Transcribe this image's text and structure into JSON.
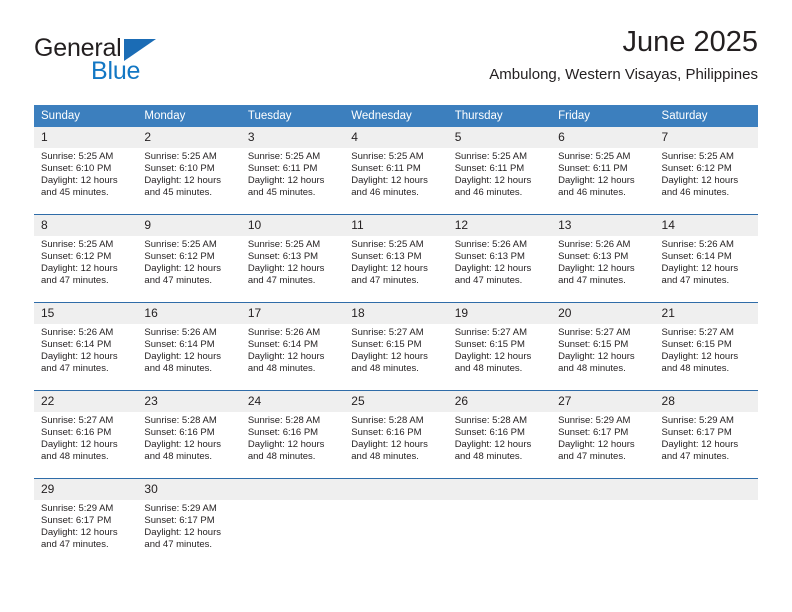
{
  "brand": {
    "name_part1": "General",
    "name_part2": "Blue",
    "triangle_color": "#1b6cb5"
  },
  "header": {
    "title": "June 2025",
    "subtitle": "Ambulong, Western Visayas, Philippines"
  },
  "theme": {
    "header_row_bg": "#3c7fbe",
    "row_divider": "#2f6ca8",
    "daynum_bg": "#efefef",
    "text": "#231f20"
  },
  "weekday_headers": [
    "Sunday",
    "Monday",
    "Tuesday",
    "Wednesday",
    "Thursday",
    "Friday",
    "Saturday"
  ],
  "labels": {
    "sunrise_prefix": "Sunrise:",
    "sunset_prefix": "Sunset:",
    "daylight_prefix": "Daylight:"
  },
  "weeks": [
    [
      {
        "day": "1",
        "sunrise": "Sunrise: 5:25 AM",
        "sunset": "Sunset: 6:10 PM",
        "daylight_line1": "Daylight: 12 hours",
        "daylight_line2": "and 45 minutes."
      },
      {
        "day": "2",
        "sunrise": "Sunrise: 5:25 AM",
        "sunset": "Sunset: 6:10 PM",
        "daylight_line1": "Daylight: 12 hours",
        "daylight_line2": "and 45 minutes."
      },
      {
        "day": "3",
        "sunrise": "Sunrise: 5:25 AM",
        "sunset": "Sunset: 6:11 PM",
        "daylight_line1": "Daylight: 12 hours",
        "daylight_line2": "and 45 minutes."
      },
      {
        "day": "4",
        "sunrise": "Sunrise: 5:25 AM",
        "sunset": "Sunset: 6:11 PM",
        "daylight_line1": "Daylight: 12 hours",
        "daylight_line2": "and 46 minutes."
      },
      {
        "day": "5",
        "sunrise": "Sunrise: 5:25 AM",
        "sunset": "Sunset: 6:11 PM",
        "daylight_line1": "Daylight: 12 hours",
        "daylight_line2": "and 46 minutes."
      },
      {
        "day": "6",
        "sunrise": "Sunrise: 5:25 AM",
        "sunset": "Sunset: 6:11 PM",
        "daylight_line1": "Daylight: 12 hours",
        "daylight_line2": "and 46 minutes."
      },
      {
        "day": "7",
        "sunrise": "Sunrise: 5:25 AM",
        "sunset": "Sunset: 6:12 PM",
        "daylight_line1": "Daylight: 12 hours",
        "daylight_line2": "and 46 minutes."
      }
    ],
    [
      {
        "day": "8",
        "sunrise": "Sunrise: 5:25 AM",
        "sunset": "Sunset: 6:12 PM",
        "daylight_line1": "Daylight: 12 hours",
        "daylight_line2": "and 47 minutes."
      },
      {
        "day": "9",
        "sunrise": "Sunrise: 5:25 AM",
        "sunset": "Sunset: 6:12 PM",
        "daylight_line1": "Daylight: 12 hours",
        "daylight_line2": "and 47 minutes."
      },
      {
        "day": "10",
        "sunrise": "Sunrise: 5:25 AM",
        "sunset": "Sunset: 6:13 PM",
        "daylight_line1": "Daylight: 12 hours",
        "daylight_line2": "and 47 minutes."
      },
      {
        "day": "11",
        "sunrise": "Sunrise: 5:25 AM",
        "sunset": "Sunset: 6:13 PM",
        "daylight_line1": "Daylight: 12 hours",
        "daylight_line2": "and 47 minutes."
      },
      {
        "day": "12",
        "sunrise": "Sunrise: 5:26 AM",
        "sunset": "Sunset: 6:13 PM",
        "daylight_line1": "Daylight: 12 hours",
        "daylight_line2": "and 47 minutes."
      },
      {
        "day": "13",
        "sunrise": "Sunrise: 5:26 AM",
        "sunset": "Sunset: 6:13 PM",
        "daylight_line1": "Daylight: 12 hours",
        "daylight_line2": "and 47 minutes."
      },
      {
        "day": "14",
        "sunrise": "Sunrise: 5:26 AM",
        "sunset": "Sunset: 6:14 PM",
        "daylight_line1": "Daylight: 12 hours",
        "daylight_line2": "and 47 minutes."
      }
    ],
    [
      {
        "day": "15",
        "sunrise": "Sunrise: 5:26 AM",
        "sunset": "Sunset: 6:14 PM",
        "daylight_line1": "Daylight: 12 hours",
        "daylight_line2": "and 47 minutes."
      },
      {
        "day": "16",
        "sunrise": "Sunrise: 5:26 AM",
        "sunset": "Sunset: 6:14 PM",
        "daylight_line1": "Daylight: 12 hours",
        "daylight_line2": "and 48 minutes."
      },
      {
        "day": "17",
        "sunrise": "Sunrise: 5:26 AM",
        "sunset": "Sunset: 6:14 PM",
        "daylight_line1": "Daylight: 12 hours",
        "daylight_line2": "and 48 minutes."
      },
      {
        "day": "18",
        "sunrise": "Sunrise: 5:27 AM",
        "sunset": "Sunset: 6:15 PM",
        "daylight_line1": "Daylight: 12 hours",
        "daylight_line2": "and 48 minutes."
      },
      {
        "day": "19",
        "sunrise": "Sunrise: 5:27 AM",
        "sunset": "Sunset: 6:15 PM",
        "daylight_line1": "Daylight: 12 hours",
        "daylight_line2": "and 48 minutes."
      },
      {
        "day": "20",
        "sunrise": "Sunrise: 5:27 AM",
        "sunset": "Sunset: 6:15 PM",
        "daylight_line1": "Daylight: 12 hours",
        "daylight_line2": "and 48 minutes."
      },
      {
        "day": "21",
        "sunrise": "Sunrise: 5:27 AM",
        "sunset": "Sunset: 6:15 PM",
        "daylight_line1": "Daylight: 12 hours",
        "daylight_line2": "and 48 minutes."
      }
    ],
    [
      {
        "day": "22",
        "sunrise": "Sunrise: 5:27 AM",
        "sunset": "Sunset: 6:16 PM",
        "daylight_line1": "Daylight: 12 hours",
        "daylight_line2": "and 48 minutes."
      },
      {
        "day": "23",
        "sunrise": "Sunrise: 5:28 AM",
        "sunset": "Sunset: 6:16 PM",
        "daylight_line1": "Daylight: 12 hours",
        "daylight_line2": "and 48 minutes."
      },
      {
        "day": "24",
        "sunrise": "Sunrise: 5:28 AM",
        "sunset": "Sunset: 6:16 PM",
        "daylight_line1": "Daylight: 12 hours",
        "daylight_line2": "and 48 minutes."
      },
      {
        "day": "25",
        "sunrise": "Sunrise: 5:28 AM",
        "sunset": "Sunset: 6:16 PM",
        "daylight_line1": "Daylight: 12 hours",
        "daylight_line2": "and 48 minutes."
      },
      {
        "day": "26",
        "sunrise": "Sunrise: 5:28 AM",
        "sunset": "Sunset: 6:16 PM",
        "daylight_line1": "Daylight: 12 hours",
        "daylight_line2": "and 48 minutes."
      },
      {
        "day": "27",
        "sunrise": "Sunrise: 5:29 AM",
        "sunset": "Sunset: 6:17 PM",
        "daylight_line1": "Daylight: 12 hours",
        "daylight_line2": "and 47 minutes."
      },
      {
        "day": "28",
        "sunrise": "Sunrise: 5:29 AM",
        "sunset": "Sunset: 6:17 PM",
        "daylight_line1": "Daylight: 12 hours",
        "daylight_line2": "and 47 minutes."
      }
    ],
    [
      {
        "day": "29",
        "sunrise": "Sunrise: 5:29 AM",
        "sunset": "Sunset: 6:17 PM",
        "daylight_line1": "Daylight: 12 hours",
        "daylight_line2": "and 47 minutes."
      },
      {
        "day": "30",
        "sunrise": "Sunrise: 5:29 AM",
        "sunset": "Sunset: 6:17 PM",
        "daylight_line1": "Daylight: 12 hours",
        "daylight_line2": "and 47 minutes."
      },
      {
        "day": "",
        "sunrise": "",
        "sunset": "",
        "daylight_line1": "",
        "daylight_line2": ""
      },
      {
        "day": "",
        "sunrise": "",
        "sunset": "",
        "daylight_line1": "",
        "daylight_line2": ""
      },
      {
        "day": "",
        "sunrise": "",
        "sunset": "",
        "daylight_line1": "",
        "daylight_line2": ""
      },
      {
        "day": "",
        "sunrise": "",
        "sunset": "",
        "daylight_line1": "",
        "daylight_line2": ""
      },
      {
        "day": "",
        "sunrise": "",
        "sunset": "",
        "daylight_line1": "",
        "daylight_line2": ""
      }
    ]
  ]
}
